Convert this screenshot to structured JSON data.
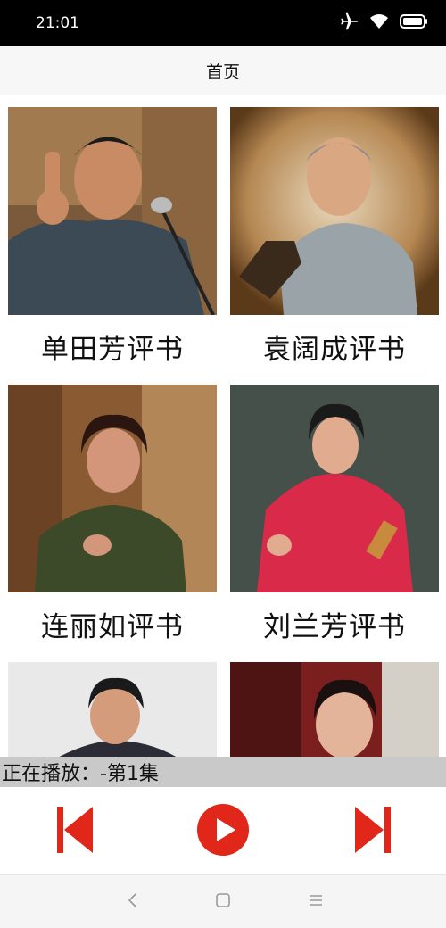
{
  "status_bar": {
    "time": "21:01",
    "icons": [
      "airplane-icon",
      "wifi-icon",
      "battery-icon"
    ]
  },
  "header": {
    "title": "首页"
  },
  "grid": {
    "items": [
      {
        "label": "单田芳评书",
        "image": "portrait-shan-tianfang"
      },
      {
        "label": "袁阔成评书",
        "image": "portrait-yuan-kuocheng"
      },
      {
        "label": "连丽如评书",
        "image": "portrait-lian-liru"
      },
      {
        "label": "刘兰芳评书",
        "image": "portrait-liu-lanfang"
      },
      {
        "label": "",
        "image": "portrait-5"
      },
      {
        "label": "",
        "image": "portrait-6"
      }
    ]
  },
  "player": {
    "now_playing": "正在播放：-第1集",
    "controls": [
      "skip-previous-icon",
      "play-icon",
      "skip-next-icon"
    ],
    "accent_color": "#e0271a"
  },
  "nav_bar": {
    "icons": [
      "back-icon",
      "home-icon",
      "menu-icon"
    ]
  }
}
